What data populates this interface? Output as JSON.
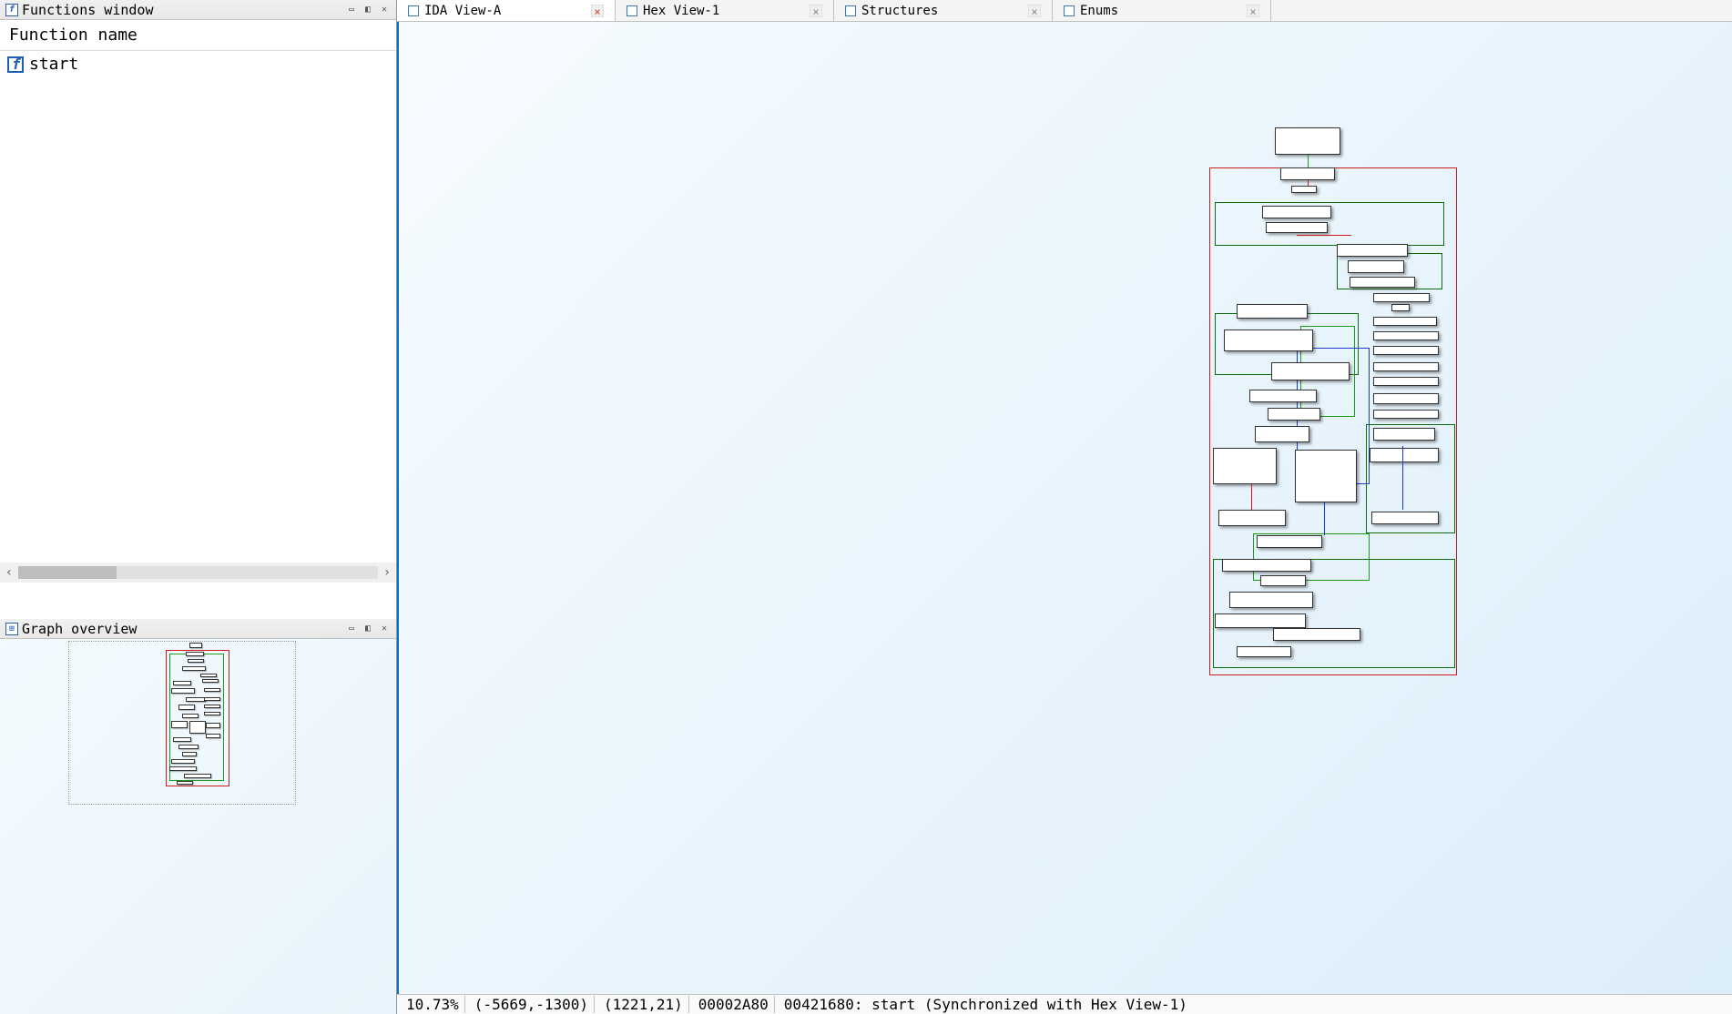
{
  "functions_panel": {
    "title": "Functions window",
    "column_header": "Function name",
    "items": [
      {
        "name": "start"
      }
    ]
  },
  "graph_overview": {
    "title": "Graph overview"
  },
  "tabs": [
    {
      "label": "IDA View-A",
      "active": true
    },
    {
      "label": "Hex View-1",
      "active": false
    },
    {
      "label": "Structures",
      "active": false
    },
    {
      "label": "Enums",
      "active": false
    }
  ],
  "status": {
    "zoom": "10.73%",
    "scroll": "(-5669,-1300)",
    "cursor": "(1221,21)",
    "offset": "00002A80",
    "addr_func": "00421680: start (Synchronized with Hex View-1)"
  }
}
